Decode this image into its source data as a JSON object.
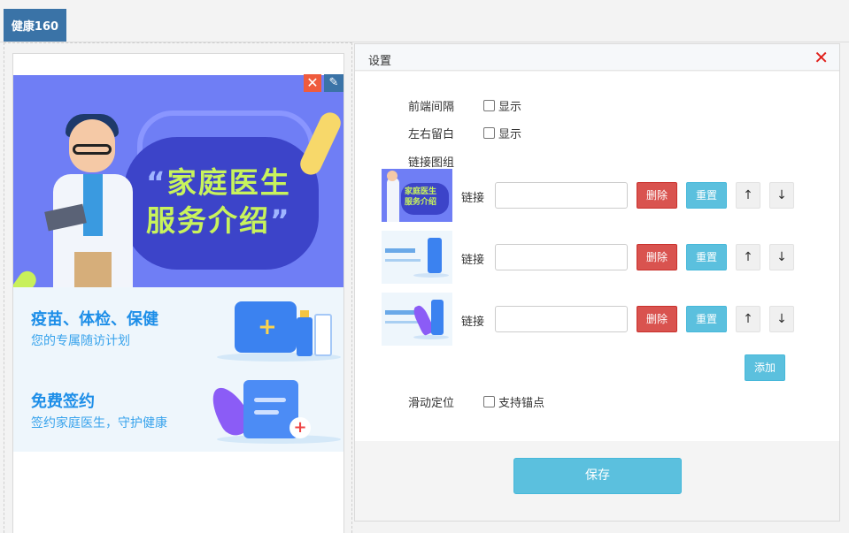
{
  "tab": {
    "label": "健康160"
  },
  "preview": {
    "banner_title_line1": "家庭医生",
    "banner_title_line2": "服务介绍",
    "quote_open": "“",
    "quote_close": "”",
    "services": [
      {
        "title": "疫苗、体检、保健",
        "subtitle": "您的专属随访计划"
      },
      {
        "title": "免费签约",
        "subtitle": "签约家庭医生，守护健康"
      }
    ],
    "close_glyph": "✕",
    "edit_glyph": "✎"
  },
  "settings": {
    "title": "设置",
    "close_glyph": "✕",
    "front_spacing": {
      "label": "前端间隔",
      "checkbox_label": "显示",
      "checked": false
    },
    "side_margin": {
      "label": "左右留白",
      "checkbox_label": "显示",
      "checked": false
    },
    "link_group_label": "链接图组",
    "link_thumb1_text": "家庭医生\n服务介绍",
    "links": [
      {
        "label": "链接",
        "value": "",
        "delete": "删除",
        "reset": "重置",
        "up": "↑",
        "down": "↓"
      },
      {
        "label": "链接",
        "value": "",
        "delete": "删除",
        "reset": "重置",
        "up": "↑",
        "down": "↓"
      },
      {
        "label": "链接",
        "value": "",
        "delete": "删除",
        "reset": "重置",
        "up": "↑",
        "down": "↓"
      }
    ],
    "add_label": "添加",
    "scroll_position": {
      "label": "滑动定位",
      "checkbox_label": "支持锚点",
      "checked": false
    },
    "save_label": "保存"
  },
  "colors": {
    "tab_bg": "#3a73a7",
    "banner_bg": "#6f7ef5",
    "danger": "#d9534f",
    "info": "#5bc0de",
    "close_red": "#e0201b"
  }
}
